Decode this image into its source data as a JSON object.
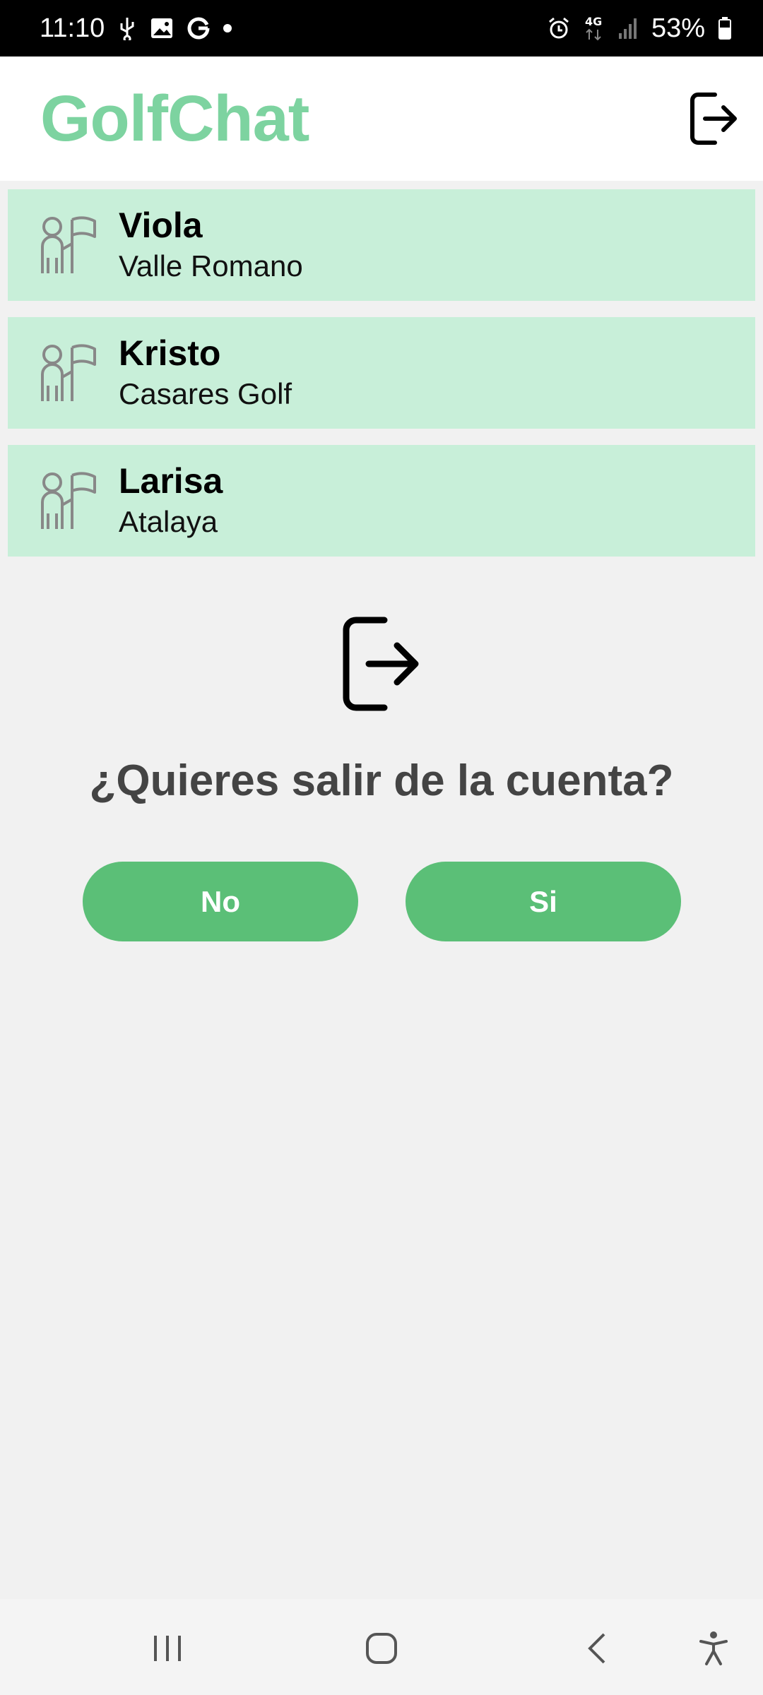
{
  "status_bar": {
    "time": "11:10",
    "battery": "53%",
    "icons": [
      "usb-icon",
      "image-icon",
      "google-icon",
      "notification-dot",
      "alarm-icon",
      "4g-icon",
      "signal-icon",
      "battery-icon"
    ]
  },
  "app": {
    "title": "GolfChat",
    "logout_icon": "logout-icon",
    "accent_color": "#7dd3a0"
  },
  "chats": [
    {
      "name": "Viola",
      "club": "Valle Romano",
      "icon": "golfer-flag-icon"
    },
    {
      "name": "Kristo",
      "club": "Casares Golf",
      "icon": "golfer-flag-icon"
    },
    {
      "name": "Larisa",
      "club": "Atalaya",
      "icon": "golfer-flag-icon"
    }
  ],
  "dialog": {
    "icon": "logout-icon",
    "title": "¿Quieres salir de la cuenta?",
    "no_label": "No",
    "yes_label": "Si",
    "button_color": "#5bbf77"
  },
  "nav_bar": {
    "icons": [
      "recents-icon",
      "home-icon",
      "back-icon",
      "accessibility-icon"
    ]
  }
}
